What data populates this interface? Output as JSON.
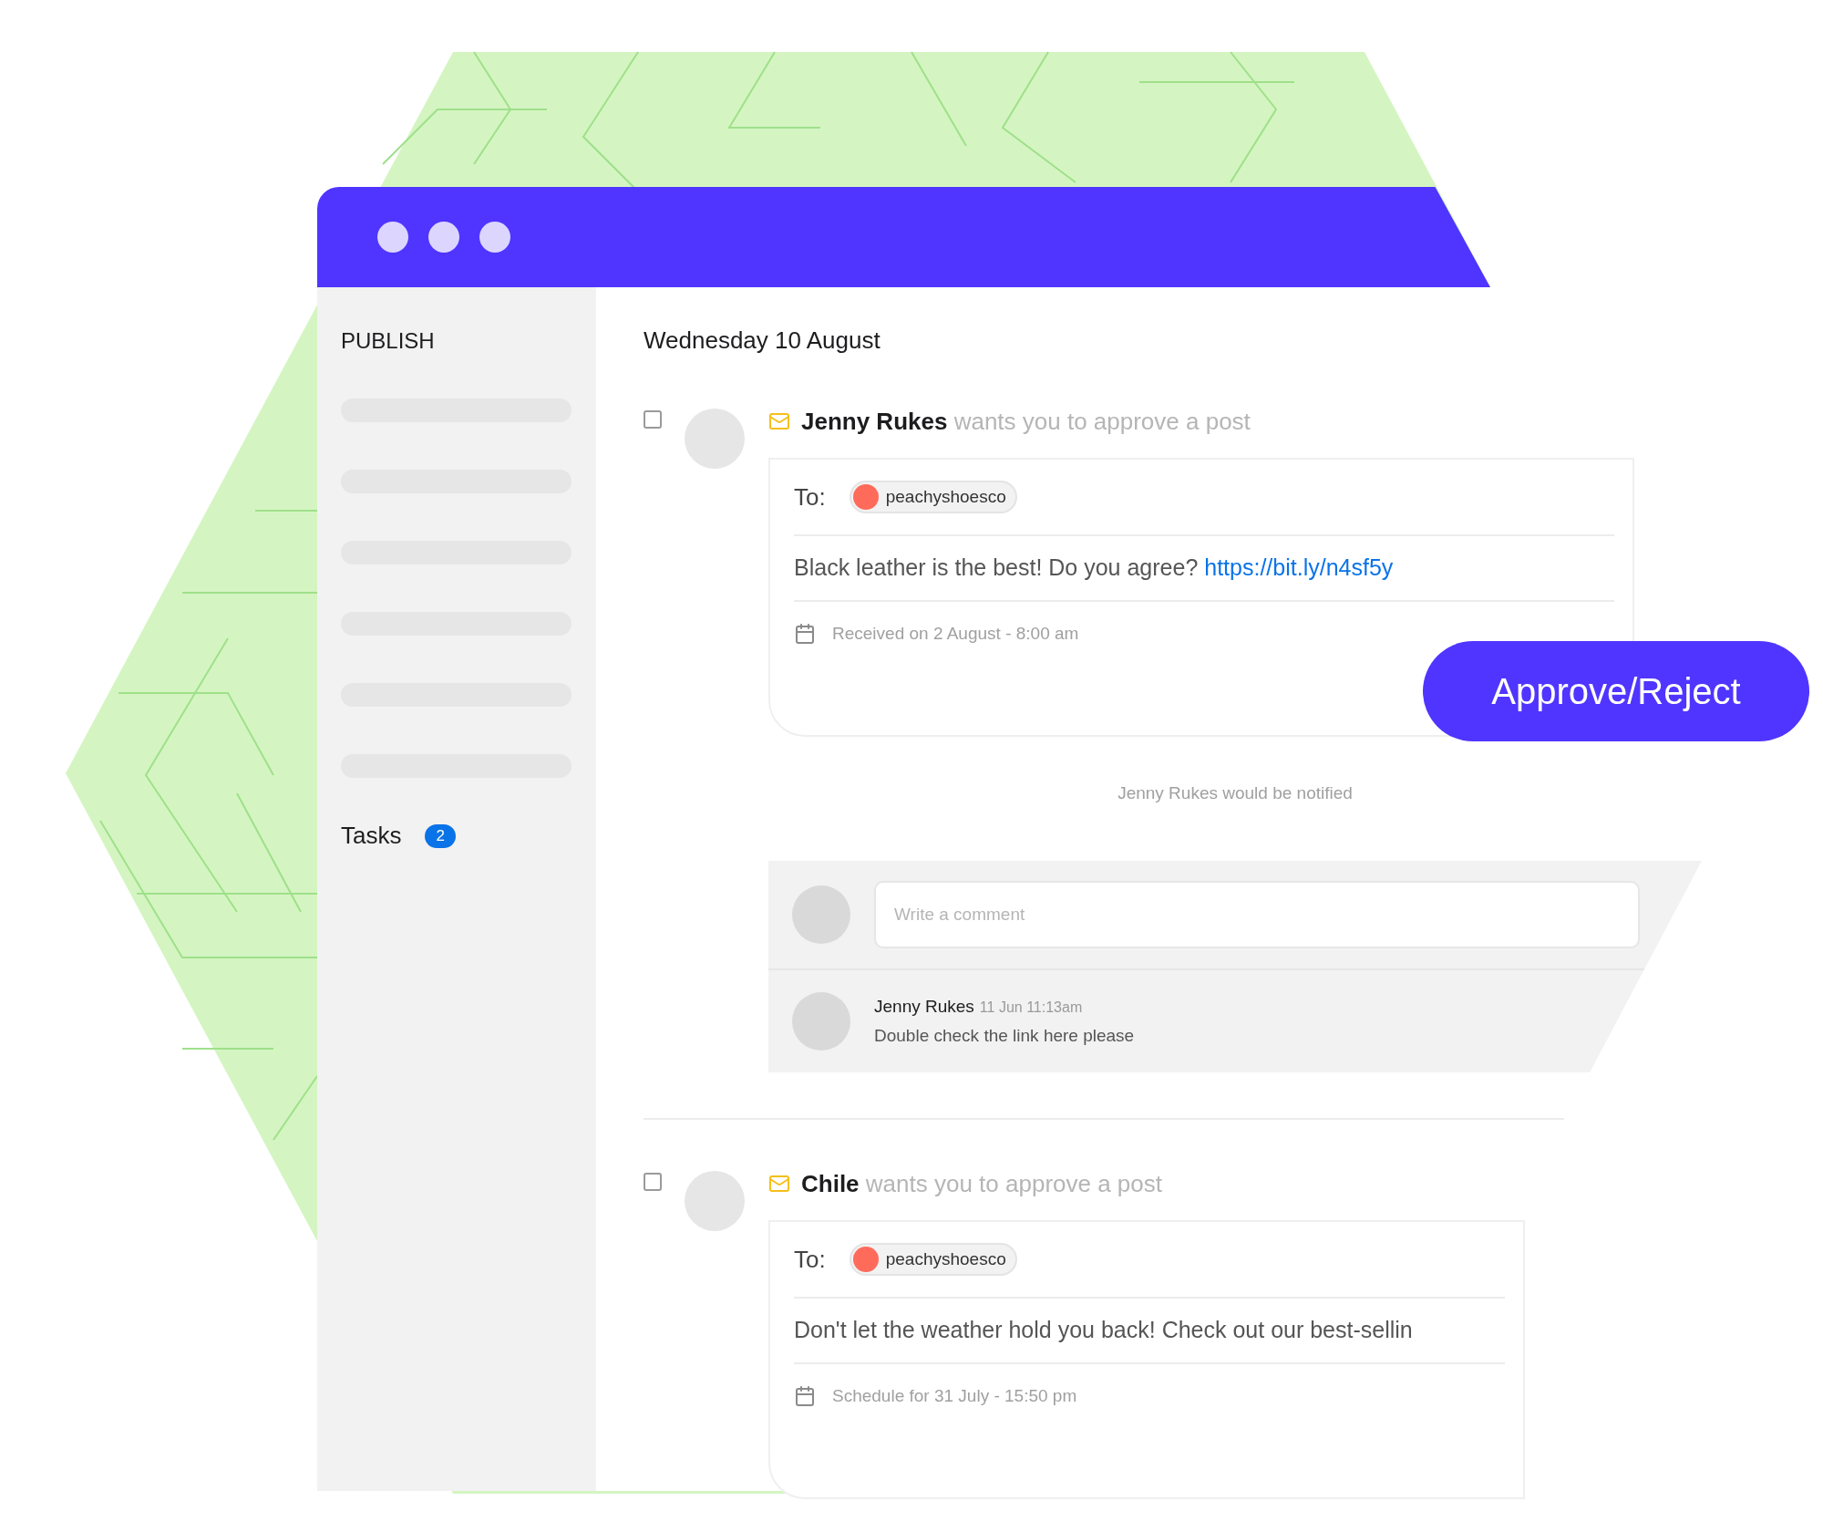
{
  "sidebar": {
    "title": "PUBLISH",
    "items": [
      {
        "label": "Tasks",
        "badge": "2"
      }
    ]
  },
  "main": {
    "date": "Wednesday 10 August"
  },
  "posts": [
    {
      "checked": false,
      "author": "Jenny Rukes",
      "action": "wants you to approve a post",
      "to_label": "To:",
      "account": "peachyshoesco",
      "text": "Black leather is the best! Do you agree?",
      "link": "https://bit.ly/n4sf5y",
      "date": "Received on 2 August - 8:00 am",
      "button": "Approve/Reject",
      "notice": "Jenny Rukes would be notified",
      "comment_placeholder": "Write a comment",
      "comments": [
        {
          "author": "Jenny Rukes",
          "time": "11 Jun 11:13am",
          "text": "Double check the link here please"
        }
      ]
    },
    {
      "checked": false,
      "author": "Chile",
      "action": "wants you to approve a post",
      "to_label": "To:",
      "account": "peachyshoesco",
      "text": "Don't let the weather hold you back! Check out our best-sellin",
      "date": "Schedule for 31 July - 15:50 pm"
    }
  ]
}
